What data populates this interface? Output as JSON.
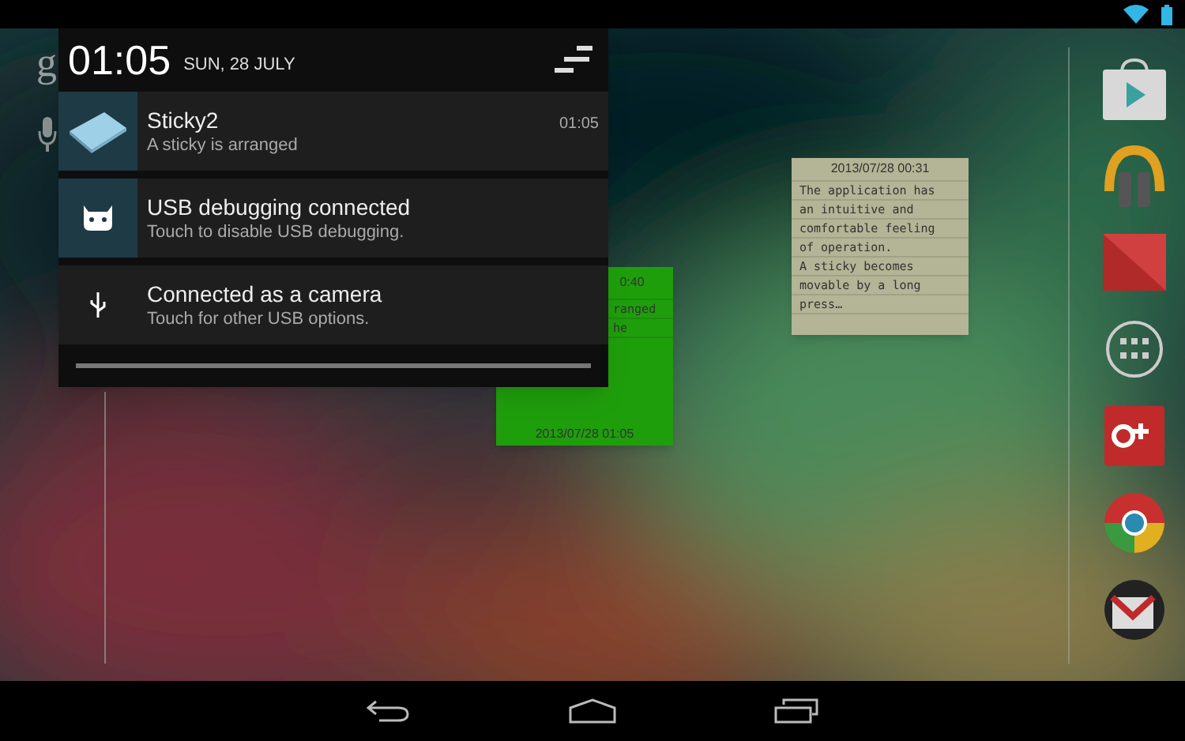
{
  "search_bar": {
    "logo_letter": "g"
  },
  "shade": {
    "time": "01:05",
    "date": "SUN, 28 JULY",
    "notifications": [
      {
        "kind": "sticky",
        "title": "Sticky2",
        "text": "A sticky is arranged",
        "time": "01:05"
      },
      {
        "kind": "debug",
        "title": "USB debugging connected",
        "text": "Touch to disable USB debugging."
      },
      {
        "kind": "usb",
        "title": "Connected as a camera",
        "text": "Touch for other USB options."
      }
    ]
  },
  "stickies": [
    {
      "color": "#1f9e0c",
      "header": "0:40",
      "lines": [
        "ranged",
        "he"
      ],
      "footer": "2013/07/28 01:05"
    },
    {
      "color": "#b4b496",
      "header": "2013/07/28 00:31",
      "lines": [
        "The application has",
        "an intuitive and",
        "comfortable feeling",
        "of operation.",
        "A sticky becomes",
        "movable by a long",
        "press…"
      ]
    }
  ]
}
